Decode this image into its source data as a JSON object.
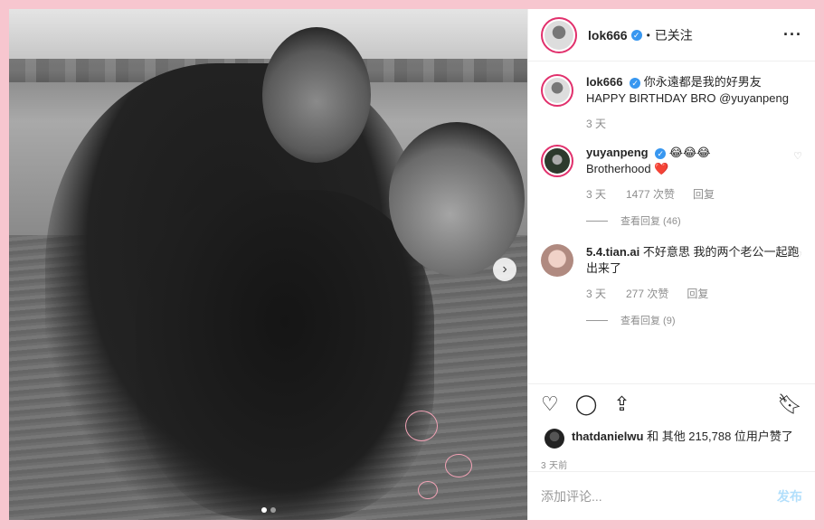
{
  "header": {
    "username": "lok666",
    "separator": "•",
    "follow_label": "已关注",
    "more_icon": "more-icon"
  },
  "photo": {
    "next_icon": "chevron-right-icon",
    "dots": 2
  },
  "comments": [
    {
      "username": "lok666",
      "text": "你永遠都是我的好男友 HAPPY BIRTHDAY BRO @yuyanpeng",
      "time": "3 天"
    },
    {
      "username": "yuyanpeng",
      "emojis": "😂😂😂",
      "text": "Brotherhood ❤️",
      "time": "3 天",
      "likes": "1477 次赞",
      "reply": "回复",
      "view_replies": "查看回复 (46)"
    },
    {
      "username": "5.4.tian.ai",
      "text": "不好意思 我的两个老公一起跑出来了",
      "time": "3 天",
      "likes": "277 次赞",
      "reply": "回复",
      "view_replies": "查看回复 (9)"
    }
  ],
  "likes": {
    "user": "thatdanielwu",
    "text": "和 其他 215,788 位用户赞了"
  },
  "time_posted": "3 天前",
  "comment_box": {
    "placeholder": "添加评论...",
    "post_label": "发布"
  }
}
